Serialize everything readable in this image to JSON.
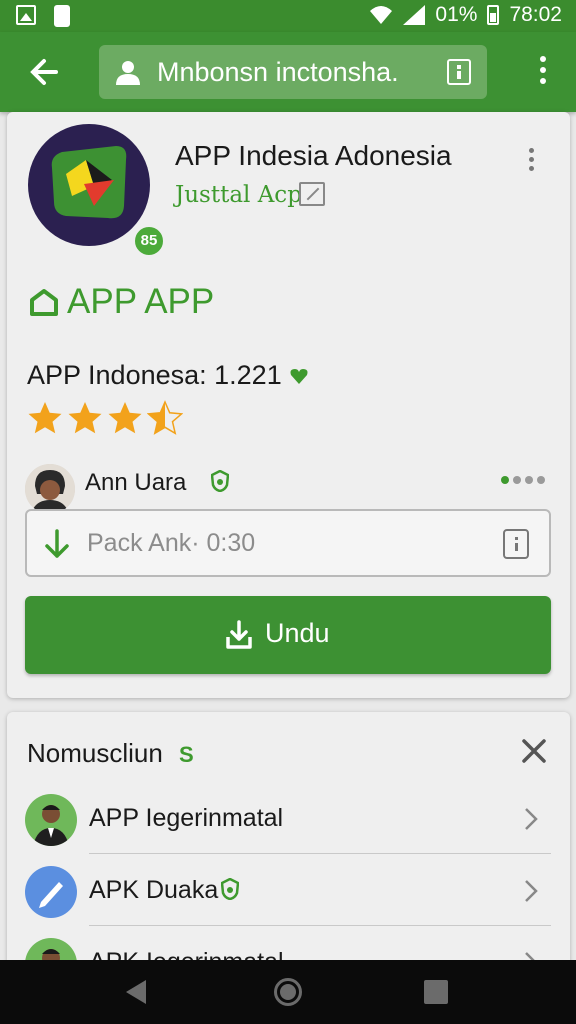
{
  "status_bar": {
    "battery_percent": "01%",
    "time": "78:02"
  },
  "toolbar": {
    "url_text": "Mnbonsn inctonsha.",
    "icons": [
      "back-arrow-icon",
      "person-icon",
      "info-icon",
      "more-vert-icon"
    ]
  },
  "app": {
    "title": "APP Indesia Adonesia",
    "subtitle": "Justtal Acp",
    "badge": "85",
    "store_label": "APP APP",
    "count_text": "APP Indonesa: 1.221",
    "rating": 3.5,
    "rating_max": 5,
    "colors": {
      "accent": "#3d9133",
      "star": "#f2a21b"
    }
  },
  "review": {
    "name": "Ann Uara"
  },
  "pack_field": {
    "value": "Pack Ank· 0:30"
  },
  "download_button": {
    "label": "Undu"
  },
  "section": {
    "title": "Nomuscliun",
    "mark": "S",
    "items": [
      {
        "label": "APP Iegerinmatal",
        "icon": "person-avatar"
      },
      {
        "label": "APK Duaka",
        "icon": "pencil-icon"
      },
      {
        "label": "APK Iegerinmatal",
        "icon": "person-avatar"
      }
    ]
  }
}
